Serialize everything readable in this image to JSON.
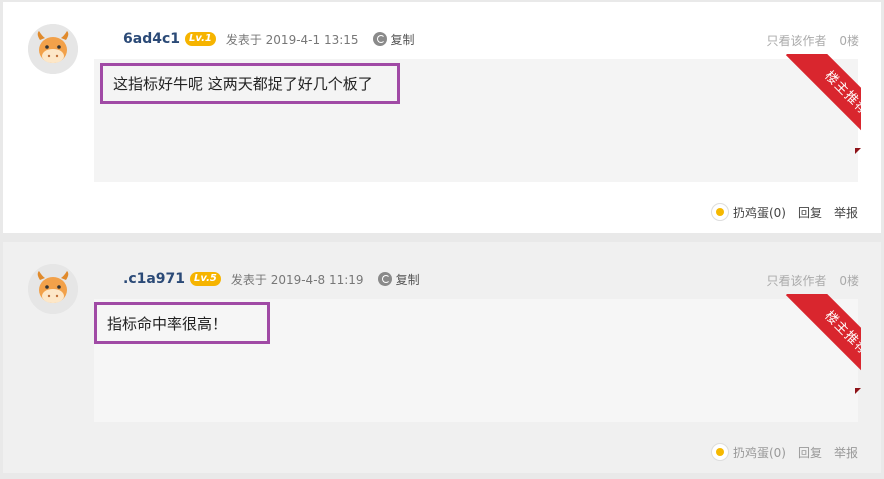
{
  "posts": [
    {
      "username": "6ad4c1",
      "level": "Lv.1",
      "posted": "发表于 2019-4-1 13:15",
      "copy_label": "复制",
      "only_author": "只看该作者",
      "floor": "0楼",
      "content": "这指标好牛呢 这两天都捉了好几个板了",
      "ribbon": "楼主推荐",
      "egg_label": "扔鸡蛋(0)",
      "reply_label": "回复",
      "report_label": "举报"
    },
    {
      "username": ".c1a971",
      "level": "Lv.5",
      "posted": "发表于 2019-4-8 11:19",
      "copy_label": "复制",
      "only_author": "只看该作者",
      "floor": "0楼",
      "content": "指标命中率很高！",
      "ribbon": "楼主推荐",
      "egg_label": "扔鸡蛋(0)",
      "reply_label": "回复",
      "report_label": "举报"
    }
  ],
  "colors": {
    "ribbon": "#d9262e",
    "highlight_border": "#a04aa5",
    "username": "#2b4a77",
    "level_badge": "#f6b400"
  },
  "icons": {
    "avatar": "cow-avatar-icon",
    "copy": "copy-icon",
    "egg": "egg-icon"
  }
}
